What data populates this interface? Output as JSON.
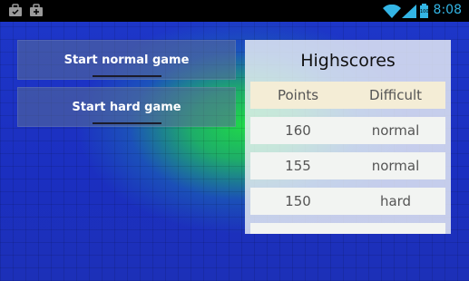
{
  "statusbar": {
    "time": "8:08",
    "battery_level": "100",
    "icons": [
      "briefcase-icon",
      "shopping-bag-icon",
      "wifi-icon",
      "signal-icon",
      "battery-icon"
    ],
    "time_color": "#33b5e5"
  },
  "menu": {
    "normal_label": "Start normal game",
    "hard_label": "Start hard game"
  },
  "highscores": {
    "title": "Highscores",
    "columns": [
      "Points",
      "Difficult"
    ],
    "rows": [
      {
        "points": "160",
        "difficulty": "normal"
      },
      {
        "points": "155",
        "difficulty": "normal"
      },
      {
        "points": "150",
        "difficulty": "hard"
      }
    ]
  }
}
